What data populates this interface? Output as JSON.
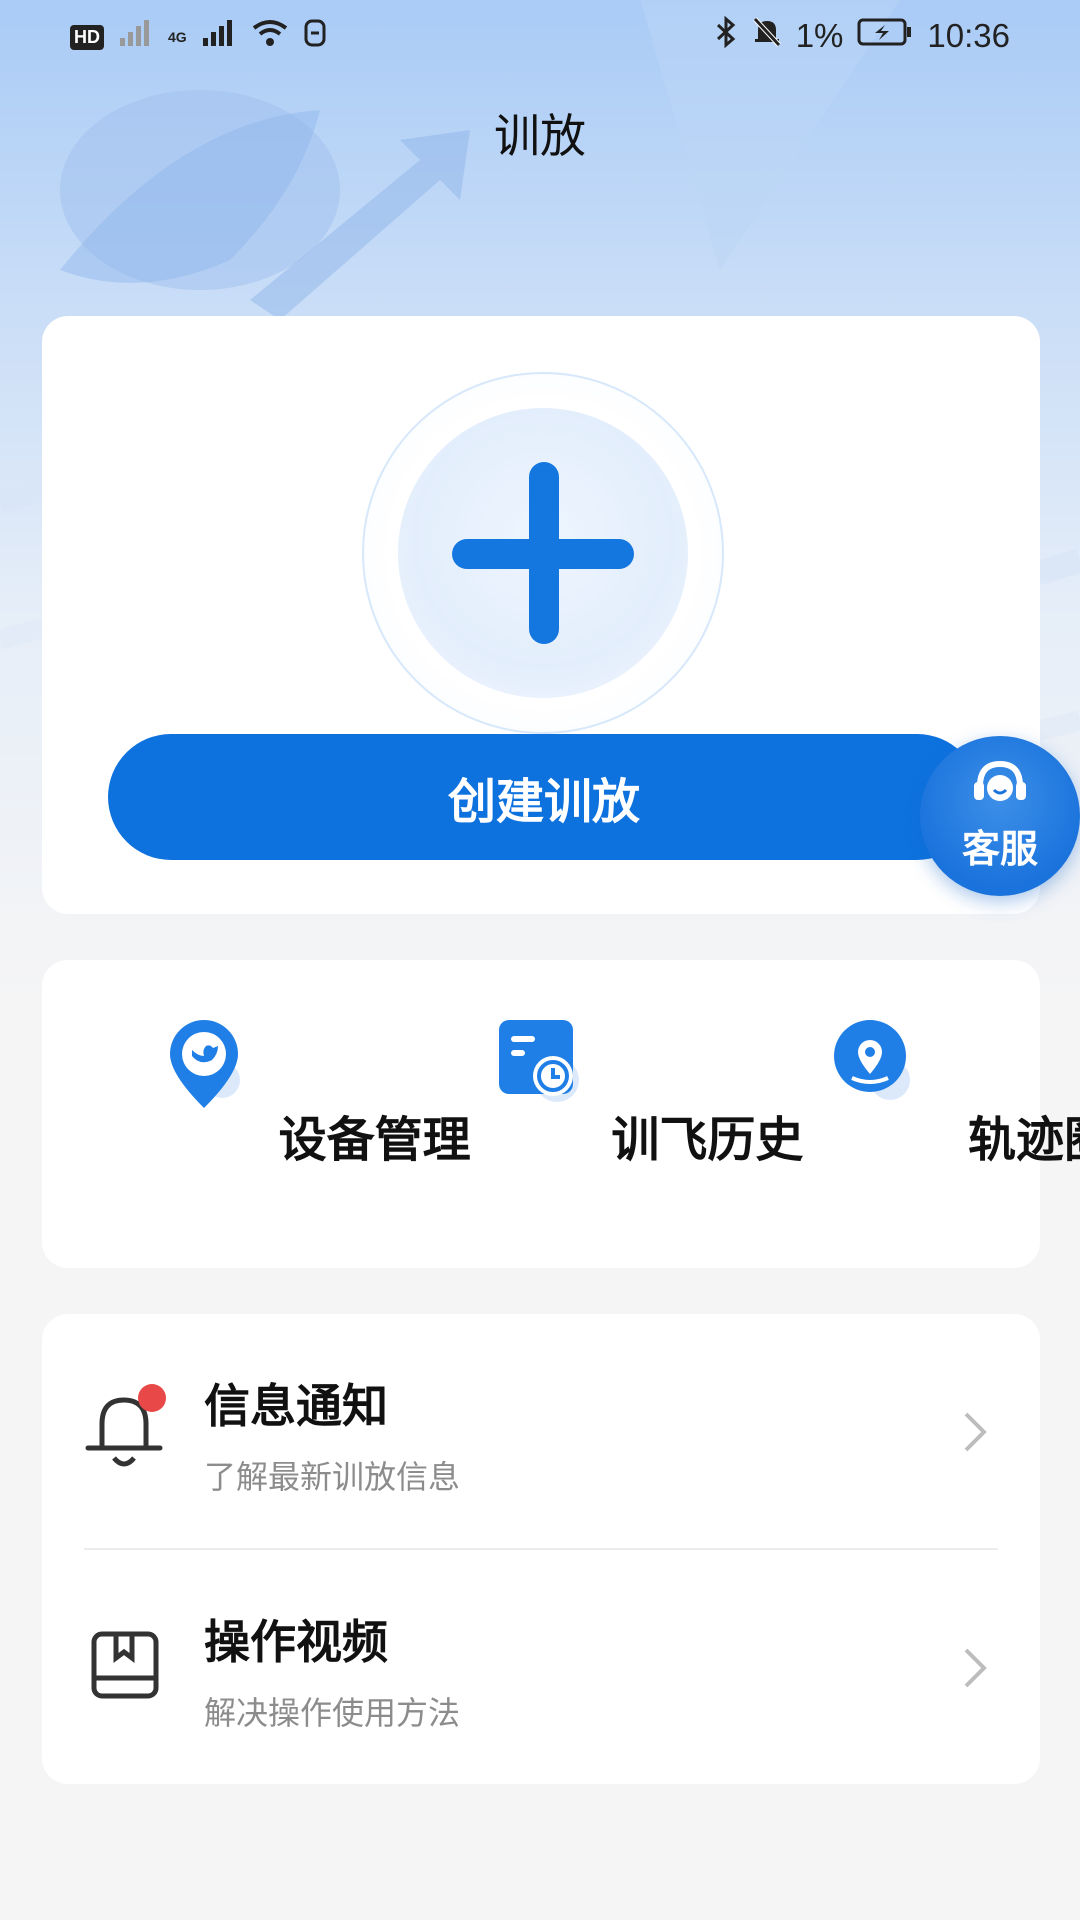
{
  "status_bar": {
    "left_badges": [
      "HD",
      "4G"
    ],
    "battery_percent": "1%",
    "time": "10:36",
    "icons": [
      "hd-icon",
      "signal-icon",
      "signal-4g-icon",
      "wifi-icon",
      "sim-icon",
      "bluetooth-icon",
      "bell-muted-icon",
      "battery-charging-icon"
    ]
  },
  "header": {
    "title": "训放"
  },
  "create": {
    "icon": "plus-icon",
    "button_label": "创建训放"
  },
  "service": {
    "label": "客服",
    "icon": "headset-icon"
  },
  "quick_actions": [
    {
      "label": "设备管理",
      "icon": "bird-location-icon"
    },
    {
      "label": "训飞历史",
      "icon": "history-clock-icon"
    },
    {
      "label": "轨迹圈",
      "icon": "route-location-icon"
    }
  ],
  "list": [
    {
      "title": "信息通知",
      "subtitle": "了解最新训放信息",
      "icon": "bell-icon",
      "badge": true
    },
    {
      "title": "操作视频",
      "subtitle": "解决操作使用方法",
      "icon": "book-icon",
      "badge": false
    }
  ],
  "colors": {
    "primary": "#0e72de",
    "badge": "#e94848",
    "subtitle": "#8c8c8c"
  }
}
